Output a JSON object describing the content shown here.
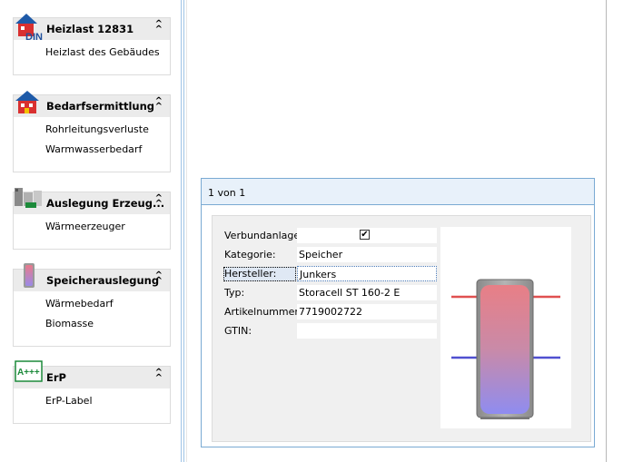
{
  "sidebar": {
    "panels": [
      {
        "title": "Heizlast 12831",
        "icon": "din-house-icon",
        "items": [
          "Heizlast des Gebäudes"
        ]
      },
      {
        "title": "Bedarfsermittlung",
        "icon": "house-icon",
        "items": [
          "Rohrleitungsverluste",
          "Warmwasserbedarf"
        ]
      },
      {
        "title": "Auslegung Erzeug...",
        "icon": "heat-generator-icon",
        "items": [
          "Wärmeerzeuger"
        ]
      },
      {
        "title": "Speicherauslegung",
        "icon": "storage-tank-icon",
        "items": [
          "Wärmebedarf",
          "Biomasse"
        ]
      },
      {
        "title": "ErP",
        "icon": "erp-label-icon",
        "icon_text": "A+++",
        "items": [
          "ErP-Label"
        ]
      }
    ]
  },
  "detail": {
    "pager": "1 von 1",
    "fields": [
      {
        "label": "Verbundanlage:",
        "value": "",
        "checkbox": true,
        "checked": true
      },
      {
        "label": "Kategorie:",
        "value": "Speicher"
      },
      {
        "label": "Hersteller:",
        "value": "Junkers",
        "selected": true
      },
      {
        "label": "Typ:",
        "value": "Storacell ST 160-2 E"
      },
      {
        "label": "Artikelnummer:",
        "value": "7719002722"
      },
      {
        "label": "GTIN:",
        "value": ""
      }
    ],
    "image": "hot-water-storage-tank-image",
    "colors": {
      "frame_border": "#7aaad3",
      "header_bg": "#e8f1fa",
      "hot_pipe": "#e05050",
      "cold_pipe": "#5050d0"
    }
  }
}
